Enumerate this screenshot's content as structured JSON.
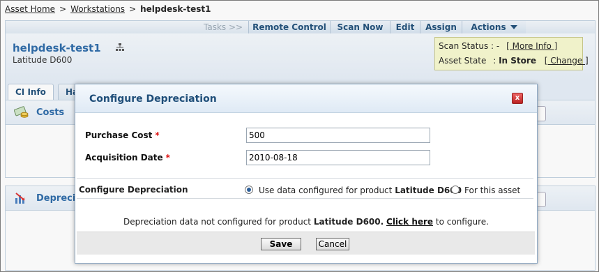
{
  "breadcrumb": {
    "home": "Asset Home",
    "workstations": "Workstations",
    "sep": ">",
    "current": "helpdesk-test1"
  },
  "taskbar": {
    "tasks_label": "Tasks >>",
    "remote_control": "Remote Control",
    "scan_now": "Scan Now",
    "edit": "Edit",
    "assign": "Assign",
    "actions": "Actions"
  },
  "asset": {
    "name": "helpdesk-test1",
    "model": "Latitude D600"
  },
  "status": {
    "scan_label": "Scan Status :",
    "scan_value": "-",
    "more_info": "[ More Info ]",
    "state_label": "Asset State",
    "state_colon": ":",
    "state_value": "In Store",
    "change": "[ Change ]"
  },
  "tabs": {
    "ci_info": "CI Info",
    "hardware_partial": "Ha"
  },
  "panels": {
    "costs": "Costs",
    "depreciation_partial": "Deprecia"
  },
  "dialog": {
    "title": "Configure Depreciation",
    "close": "x",
    "purchase_cost_label": "Purchase Cost",
    "purchase_cost_value": "500",
    "acquisition_date_label": "Acquisition Date",
    "acquisition_date_value": "2010-08-18",
    "required_mark": "*",
    "configure_label": "Configure Depreciation",
    "option_product_prefix": "Use data configured for product",
    "option_product_name": "Latitude D600",
    "option_asset": "For this asset",
    "message_prefix": "Depreciation data not configured for product",
    "message_product": "Latitude D600.",
    "message_link": "Click here",
    "message_suffix": "to configure.",
    "save": "Save",
    "cancel": "Cancel"
  },
  "colors": {
    "accent": "#2c6aa8",
    "header_text": "#1f4e79",
    "status_bg": "#f7f9cf",
    "required": "#dd1111"
  }
}
